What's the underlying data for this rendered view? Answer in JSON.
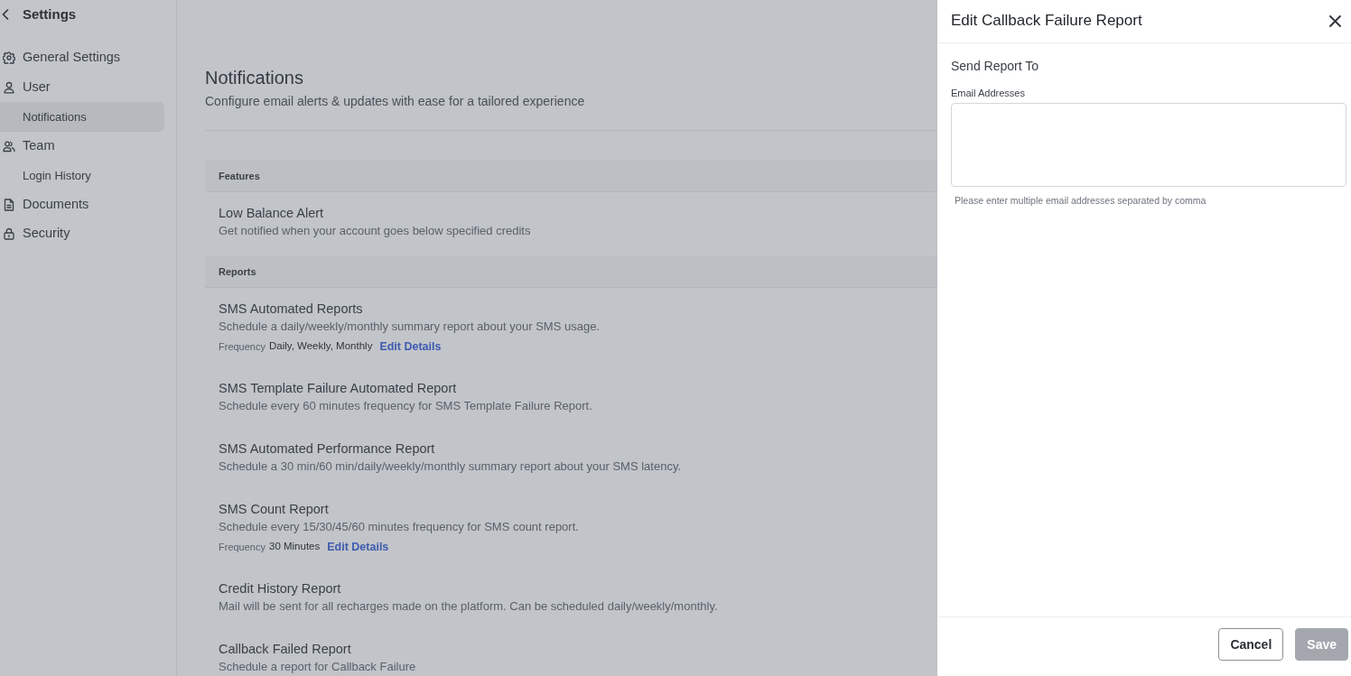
{
  "sidebar": {
    "title": "Settings",
    "items": [
      {
        "label": "General Settings",
        "kind": "top",
        "selected": false
      },
      {
        "label": "User",
        "kind": "top",
        "selected": false
      },
      {
        "label": "Notifications",
        "kind": "sub",
        "selected": true
      },
      {
        "label": "Team",
        "kind": "top",
        "selected": false
      },
      {
        "label": "Login History",
        "kind": "sub",
        "selected": false
      },
      {
        "label": "Documents",
        "kind": "top",
        "selected": false
      },
      {
        "label": "Security",
        "kind": "top",
        "selected": false
      }
    ]
  },
  "page": {
    "title": "Notifications",
    "subtitle": "Configure email alerts & updates with ease for a tailored experience",
    "sections": [
      {
        "heading": "Features",
        "items": [
          {
            "title": "Low Balance Alert",
            "description": "Get notified when your account goes below specified credits"
          }
        ]
      },
      {
        "heading": "Reports",
        "items": [
          {
            "title": "SMS Automated Reports",
            "description": "Schedule a daily/weekly/monthly summary report about your SMS usage.",
            "frequency": {
              "label": "Frequency",
              "value": "Daily, Weekly, Monthly"
            },
            "action": "Edit Details"
          },
          {
            "title": "SMS Template Failure Automated Report",
            "description": "Schedule every 60 minutes frequency for SMS Template Failure Report."
          },
          {
            "title": "SMS Automated Performance Report",
            "description": "Schedule a 30 min/60 min/daily/weekly/monthly summary report about your SMS latency."
          },
          {
            "title": "SMS Count Report",
            "description": "Schedule every 15/30/45/60 minutes frequency for SMS count report.",
            "frequency": {
              "label": "Frequency",
              "value": "30 Minutes"
            },
            "action": "Edit Details"
          },
          {
            "title": "Credit History Report",
            "description": "Mail will be sent for all recharges made on the platform. Can be scheduled daily/weekly/monthly."
          },
          {
            "title": "Callback Failed Report",
            "description": "Schedule a report for Callback Failure"
          }
        ]
      }
    ]
  },
  "drawer": {
    "title": "Edit Callback Failure Report",
    "heading": "Send Report To",
    "field": {
      "label": "Email Addresses",
      "help": "Please enter multiple email addresses separated by comma"
    },
    "buttons": [
      {
        "label": "Cancel",
        "kind": "secondary",
        "disabled": false
      },
      {
        "label": "Save",
        "kind": "primary",
        "disabled": true
      }
    ]
  }
}
